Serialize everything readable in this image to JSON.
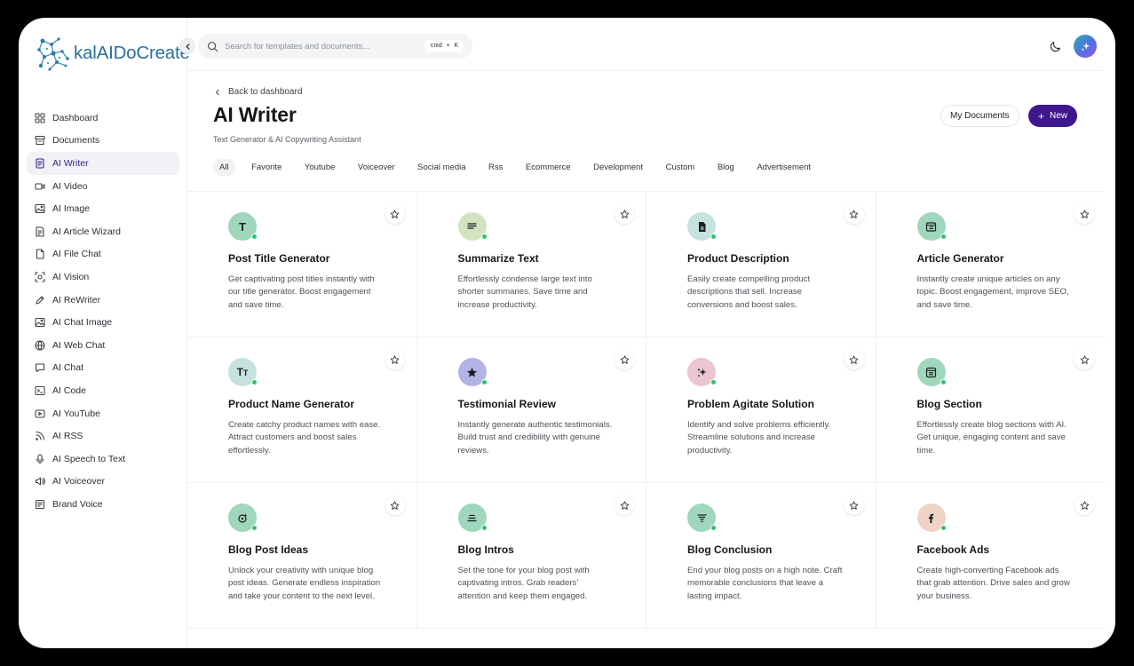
{
  "app": {
    "logo_text": "kalAIDoCreate"
  },
  "sidebar": {
    "items": [
      {
        "label": "Dashboard",
        "icon": "grid-icon"
      },
      {
        "label": "Documents",
        "icon": "archive-icon"
      },
      {
        "label": "AI Writer",
        "icon": "document-icon",
        "active": true
      },
      {
        "label": "AI Video",
        "icon": "video-icon"
      },
      {
        "label": "AI Image",
        "icon": "image-icon"
      },
      {
        "label": "AI Article Wizard",
        "icon": "article-icon"
      },
      {
        "label": "AI File Chat",
        "icon": "file-icon"
      },
      {
        "label": "AI Vision",
        "icon": "scan-icon"
      },
      {
        "label": "AI ReWriter",
        "icon": "pen-icon"
      },
      {
        "label": "AI Chat Image",
        "icon": "image-icon"
      },
      {
        "label": "AI Web Chat",
        "icon": "globe-icon"
      },
      {
        "label": "AI Chat",
        "icon": "chat-icon"
      },
      {
        "label": "AI Code",
        "icon": "terminal-icon"
      },
      {
        "label": "AI YouTube",
        "icon": "play-icon"
      },
      {
        "label": "AI RSS",
        "icon": "rss-icon"
      },
      {
        "label": "AI Speech to Text",
        "icon": "microphone-icon"
      },
      {
        "label": "AI Voiceover",
        "icon": "speaker-icon"
      },
      {
        "label": "Brand Voice",
        "icon": "brand-icon"
      }
    ]
  },
  "header": {
    "search_placeholder": "Search for templates and documents...",
    "shortcut": "cmd + K"
  },
  "page": {
    "back_label": "Back to dashboard",
    "title": "AI Writer",
    "subtitle": "Text Generator & AI Copywriting Assistant",
    "my_documents_label": "My Documents",
    "new_label": "New"
  },
  "tabs": [
    "All",
    "Favorite",
    "Youtube",
    "Voiceover",
    "Social media",
    "Rss",
    "Ecommerce",
    "Development",
    "Custom",
    "Blog",
    "Advertisement"
  ],
  "cards": [
    {
      "title": "Post Title Generator",
      "desc": "Get captivating post titles instantly with our title generator. Boost engagement and save time.",
      "icon": "letter-t-icon",
      "bg": "#9fd7bd"
    },
    {
      "title": "Summarize Text",
      "desc": "Effortlessly condense large text into shorter summaries. Save time and increase productivity.",
      "icon": "text-lines-icon",
      "bg": "#d3e3bf"
    },
    {
      "title": "Product Description",
      "desc": "Easily create compelling product descriptions that sell. Increase conversions and boost sales.",
      "icon": "file-text-icon",
      "bg": "#c6e2df"
    },
    {
      "title": "Article Generator",
      "desc": "Instantly create unique articles on any topic. Boost engagement, improve SEO, and save time.",
      "icon": "layout-icon",
      "bg": "#9fd7bd"
    },
    {
      "title": "Product Name Generator",
      "desc": "Create catchy product names with ease. Attract customers and boost sales effortlessly.",
      "icon": "typography-icon",
      "bg": "#c6e2df"
    },
    {
      "title": "Testimonial Review",
      "desc": "Instantly generate authentic testimonials. Build trust and credibility with genuine reviews.",
      "icon": "star-filled-icon",
      "bg": "#b4b3e5"
    },
    {
      "title": "Problem Agitate Solution",
      "desc": "Identify and solve problems efficiently. Streamline solutions and increase productivity.",
      "icon": "sparkles-icon",
      "bg": "#ebc5cf"
    },
    {
      "title": "Blog Section",
      "desc": "Effortlessly create blog sections with AI. Get unique, engaging content and save time.",
      "icon": "browser-icon",
      "bg": "#9fd7bd"
    },
    {
      "title": "Blog Post Ideas",
      "desc": "Unlock your creativity with unique blog post ideas. Generate endless inspiration and take your content to the next level.",
      "icon": "bulb-icon",
      "bg": "#9fd7bd"
    },
    {
      "title": "Blog Intros",
      "desc": "Set the tone for your blog post with captivating intros. Grab readers' attention and keep them engaged.",
      "icon": "align-center-icon",
      "bg": "#9fd7bd"
    },
    {
      "title": "Blog Conclusion",
      "desc": "End your blog posts on a high note. Craft memorable conclusions that leave a lasting impact.",
      "icon": "filter-lines-icon",
      "bg": "#9fd7bd"
    },
    {
      "title": "Facebook Ads",
      "desc": "Create high-converting Facebook ads that grab attention. Drive sales and grow your business.",
      "icon": "facebook-icon",
      "bg": "#f0d2c6"
    }
  ],
  "colors": {
    "accent": "#3e178f",
    "online": "#2ec26d",
    "logo": "#2d6f9a"
  }
}
